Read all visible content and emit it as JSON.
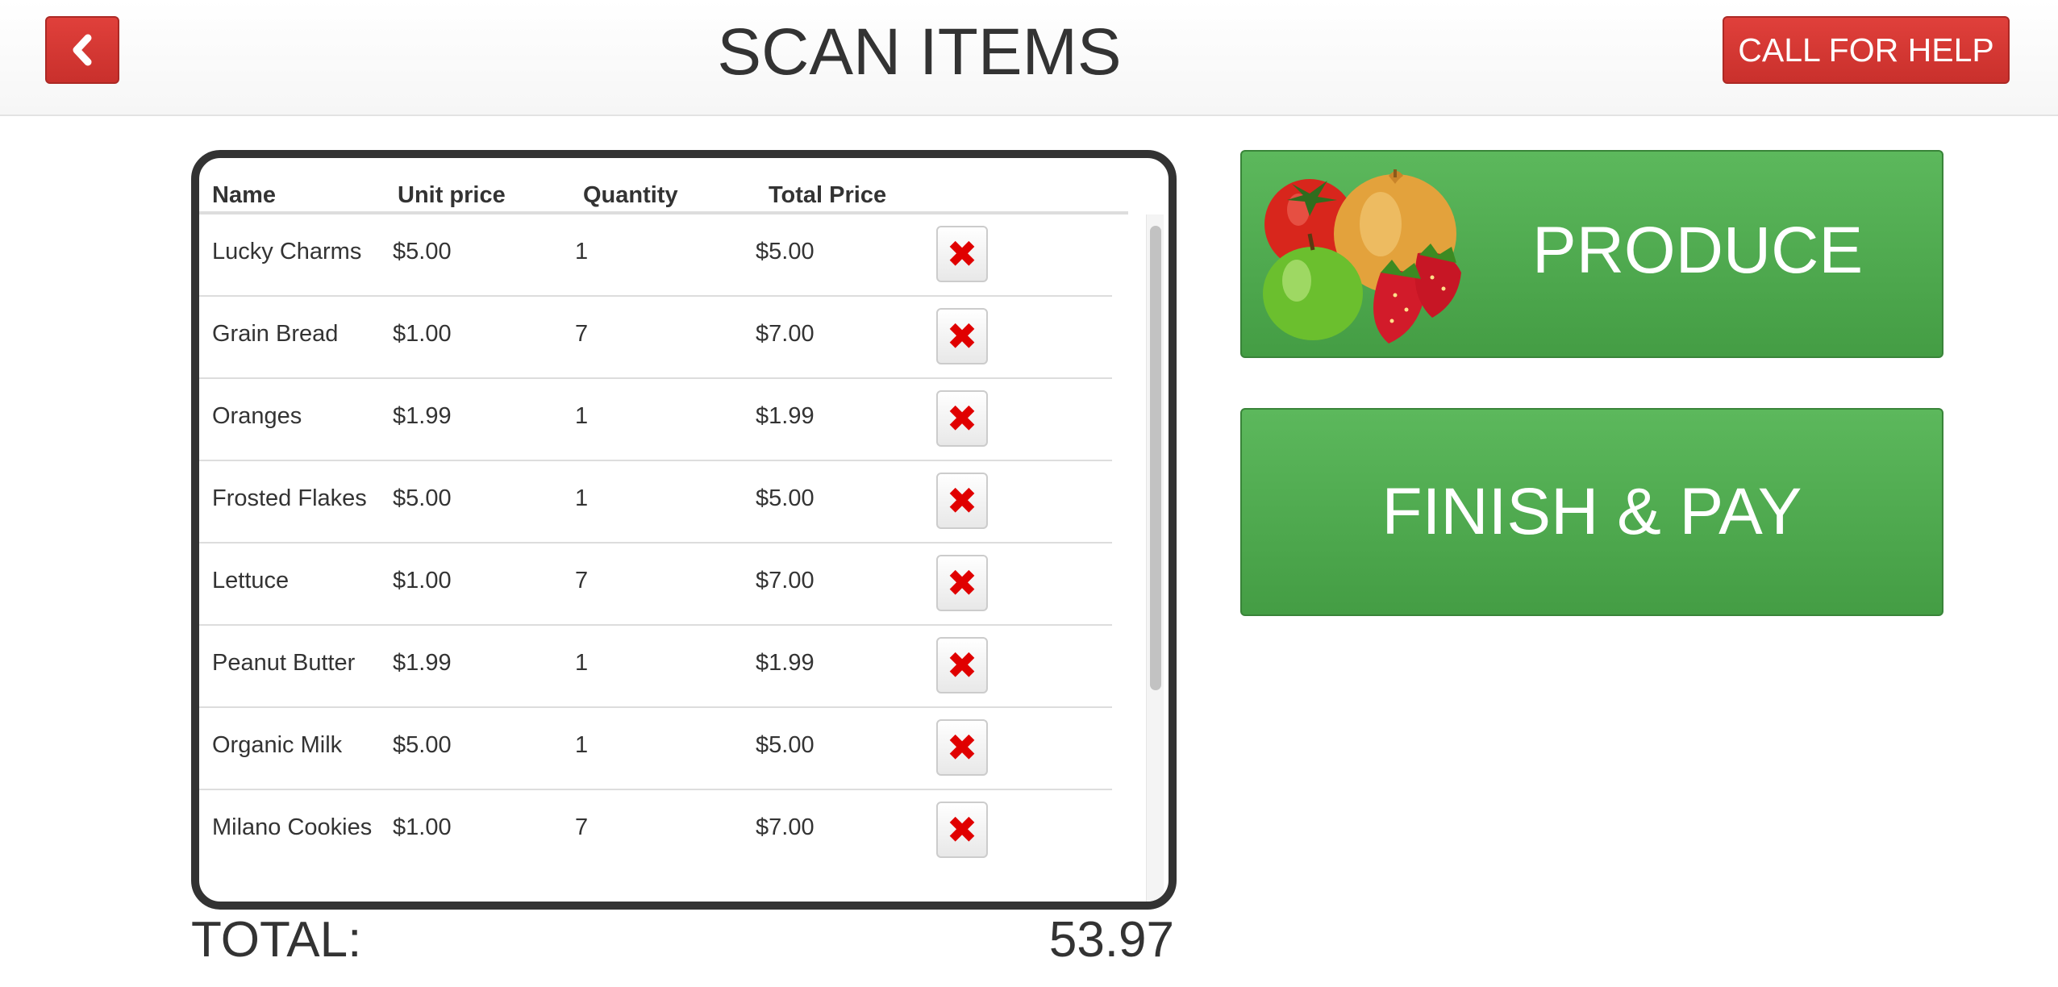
{
  "header": {
    "title": "SCAN ITEMS",
    "back_icon": "chevron-left-icon",
    "help_label": "CALL FOR HELP"
  },
  "colors": {
    "danger": "#d9534f",
    "success": "#5cb85c",
    "remove_icon": "#e00000",
    "panel_border": "#333333"
  },
  "cart": {
    "columns": [
      "Name",
      "Unit price",
      "Quantity",
      "Total Price"
    ],
    "remove_icon": "x-icon",
    "items": [
      {
        "name": "Lucky Charms",
        "unit_price": "$5.00",
        "quantity": "1",
        "total": "$5.00"
      },
      {
        "name": "Grain Bread",
        "unit_price": "$1.00",
        "quantity": "7",
        "total": "$7.00"
      },
      {
        "name": "Oranges",
        "unit_price": "$1.99",
        "quantity": "1",
        "total": "$1.99"
      },
      {
        "name": "Frosted Flakes",
        "unit_price": "$5.00",
        "quantity": "1",
        "total": "$5.00"
      },
      {
        "name": "Lettuce",
        "unit_price": "$1.00",
        "quantity": "7",
        "total": "$7.00"
      },
      {
        "name": "Peanut Butter",
        "unit_price": "$1.99",
        "quantity": "1",
        "total": "$1.99"
      },
      {
        "name": "Organic Milk",
        "unit_price": "$5.00",
        "quantity": "1",
        "total": "$5.00"
      },
      {
        "name": "Milano Cookies",
        "unit_price": "$1.00",
        "quantity": "7",
        "total": "$7.00"
      }
    ]
  },
  "summary": {
    "total_label": "TOTAL:",
    "total_value": "53.97"
  },
  "actions": {
    "produce_label": "PRODUCE",
    "produce_image": "produce-image",
    "finish_label": "FINISH & PAY"
  }
}
